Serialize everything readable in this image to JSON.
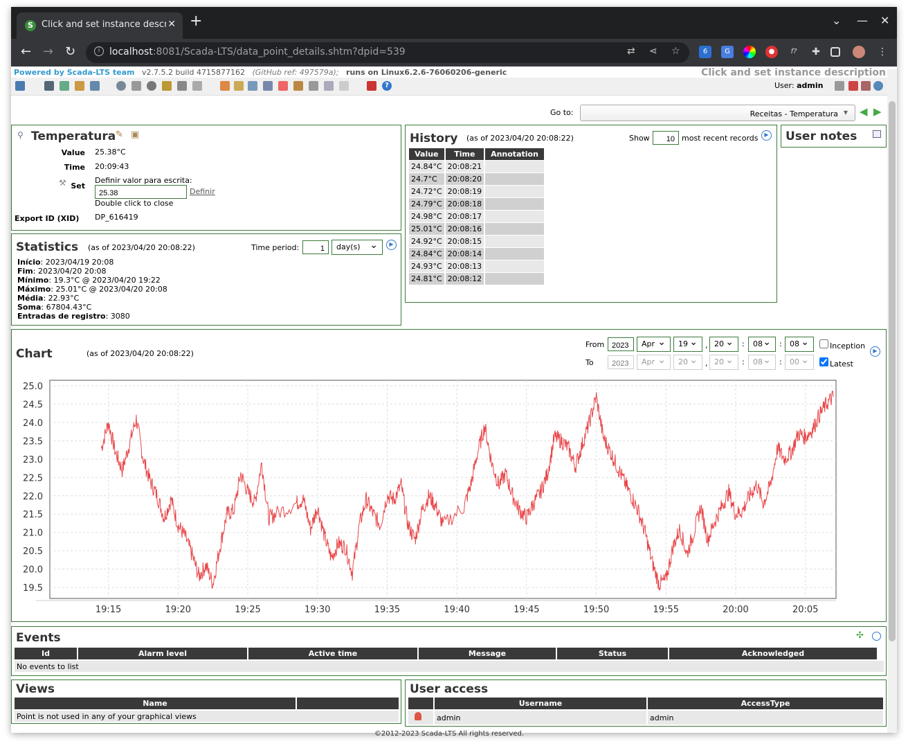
{
  "browser": {
    "tab_title": "Click and set instance descrip",
    "url_host": "localhost",
    "url_rest": ":8081/Scada-LTS/data_point_details.shtm?dpid=539",
    "ext_badge": "6"
  },
  "header": {
    "powered": "Powered by Scada-LTS team",
    "version": "v2.7.5.2 build 4715877162",
    "github": "(GitHub ref: 497579a);",
    "runs_on": "runs on Linux6.2.6-76060206-generic",
    "instance_description": "Click and set instance description",
    "user_label": "User:",
    "user_name": "admin"
  },
  "goto": {
    "label": "Go to:",
    "selected": "Receitas - Temperatura"
  },
  "point": {
    "title": "Temperatura",
    "value_label": "Value",
    "value": "25.38°C",
    "time_label": "Time",
    "time": "20:09:43",
    "set_label": "Set",
    "set_prompt": "Definir valor para escrita:",
    "set_input": "25.38",
    "set_button": "Definir",
    "set_hint": "Double click to close",
    "xid_label": "Export ID (XID)",
    "xid": "DP_616419"
  },
  "statistics": {
    "title": "Statistics",
    "asof": "(as of 2023/04/20 20:08:22)",
    "period_label": "Time period:",
    "period_value": "1",
    "period_unit": "day(s)",
    "lines": [
      {
        "k": "Início",
        "v": ": 2023/04/19 20:08"
      },
      {
        "k": "Fim",
        "v": ": 2023/04/20 20:08"
      },
      {
        "k": "Mínimo",
        "v": ": 19.3°C @ 2023/04/20 19:22"
      },
      {
        "k": "Máximo",
        "v": ": 25.01°C @ 2023/04/20 20:08"
      },
      {
        "k": "Média",
        "v": ": 22.93°C"
      },
      {
        "k": "Soma",
        "v": ": 67804.43°C"
      },
      {
        "k": "Entradas de registro",
        "v": ": 3080"
      }
    ]
  },
  "history": {
    "title": "History",
    "asof": "(as of 2023/04/20 20:08:22)",
    "show_label": "Show",
    "show_value": "10",
    "show_suffix": "most recent records",
    "columns": [
      "Value",
      "Time",
      "Annotation"
    ],
    "rows": [
      [
        "24.84°C",
        "20:08:21",
        ""
      ],
      [
        "24.7°C",
        "20:08:20",
        ""
      ],
      [
        "24.72°C",
        "20:08:19",
        ""
      ],
      [
        "24.79°C",
        "20:08:18",
        ""
      ],
      [
        "24.98°C",
        "20:08:17",
        ""
      ],
      [
        "25.01°C",
        "20:08:16",
        ""
      ],
      [
        "24.92°C",
        "20:08:15",
        ""
      ],
      [
        "24.84°C",
        "20:08:14",
        ""
      ],
      [
        "24.93°C",
        "20:08:13",
        ""
      ],
      [
        "24.81°C",
        "20:08:12",
        ""
      ]
    ]
  },
  "notes": {
    "title": "User notes"
  },
  "chart": {
    "title": "Chart",
    "asof": "(as of 2023/04/20 20:08:22)",
    "from_label": "From",
    "to_label": "To",
    "from": {
      "year": "2023",
      "month": "Apr",
      "day": "19",
      "hour": "20",
      "minute": "08",
      "second": "08"
    },
    "to": {
      "year": "2023",
      "month": "Apr",
      "day": "20",
      "hour": "20",
      "minute": "08",
      "second": "00"
    },
    "inception_label": "Inception",
    "latest_label": "Latest",
    "inception_checked": false,
    "latest_checked": true
  },
  "chart_data": {
    "type": "line",
    "title": "",
    "xlabel": "",
    "ylabel": "",
    "x_ticks": [
      "19:15",
      "19:20",
      "19:25",
      "19:30",
      "19:35",
      "19:40",
      "19:45",
      "19:50",
      "19:55",
      "20:00",
      "20:05"
    ],
    "y_ticks": [
      "25.0",
      "24.5",
      "24.0",
      "23.5",
      "23.0",
      "22.5",
      "22.0",
      "21.5",
      "21.0",
      "20.5",
      "20.0",
      "19.5"
    ],
    "ylim": [
      19.2,
      25.15
    ],
    "xlim_minutes": [
      -4.2,
      52.2
    ],
    "color": "#e8474a",
    "grid": true,
    "series": [
      {
        "x_minutes_from_19_15": [
          -0.5,
          0,
          0.5,
          1,
          1.5,
          2,
          2.5,
          3,
          3.5,
          4,
          4.5,
          5,
          5.5,
          6,
          6.5,
          7,
          7.5,
          8,
          8.5,
          9,
          9.5,
          10,
          10.5,
          11,
          11.5,
          12,
          13.5,
          14,
          14.5,
          15,
          15.5,
          16,
          16.5,
          17,
          17.5,
          18,
          18.5,
          19,
          19.5,
          20,
          20.5,
          21,
          21.5,
          22,
          22.5,
          23,
          23.5,
          24,
          25.5,
          26,
          26.5,
          27,
          27.5,
          28,
          28.5,
          29,
          29.5,
          30,
          30.5,
          31,
          31.5,
          32,
          32.5,
          33,
          33.5,
          34,
          34.5,
          35,
          35.5,
          36,
          36.5,
          37,
          37.5,
          38,
          38.5,
          39,
          39.5,
          40,
          40.5,
          41,
          41.5,
          42,
          42.5,
          43,
          43.5,
          44,
          44.5,
          45,
          45.5,
          46,
          46.5,
          47,
          47.5,
          48,
          48.5,
          49,
          49.5,
          50,
          50.5,
          51,
          51.5,
          52
        ],
        "values": [
          23.3,
          24.0,
          23.2,
          22.7,
          23.4,
          24.1,
          23.0,
          22.4,
          22.0,
          21.4,
          21.9,
          21.2,
          20.9,
          20.4,
          19.8,
          20.1,
          19.6,
          20.6,
          21.5,
          21.6,
          22.6,
          22.1,
          21.8,
          22.9,
          21.4,
          21.5,
          21.8,
          21.9,
          21.1,
          21.7,
          20.9,
          20.3,
          20.7,
          20.6,
          19.9,
          21.2,
          21.9,
          21.5,
          21.2,
          22.0,
          21.9,
          22.3,
          21.2,
          20.8,
          21.6,
          22.0,
          21.7,
          21.2,
          21.7,
          22.3,
          23.2,
          23.9,
          22.9,
          22.3,
          22.6,
          22.0,
          21.6,
          21.4,
          21.8,
          22.1,
          22.6,
          23.6,
          23.5,
          23.3,
          22.8,
          23.4,
          24.0,
          24.7,
          23.6,
          23.2,
          22.8,
          22.4,
          22.0,
          21.6,
          21.0,
          20.2,
          19.6,
          19.7,
          20.6,
          21.1,
          20.4,
          21.0,
          21.7,
          20.8,
          21.3,
          21.7,
          22.1,
          21.5,
          21.6,
          22.0,
          22.3,
          21.8,
          22.3,
          23.3,
          23.0,
          23.2,
          23.7,
          23.6,
          23.8,
          24.2,
          24.5,
          24.7
        ]
      }
    ]
  },
  "events": {
    "title": "Events",
    "columns": [
      "Id",
      "Alarm level",
      "Active time",
      "Message",
      "Status",
      "Acknowledged"
    ],
    "empty": "No events to list"
  },
  "views": {
    "title": "Views",
    "columns": [
      "Name",
      ""
    ],
    "empty": "Point is not used in any of your graphical views"
  },
  "access": {
    "title": "User access",
    "columns": [
      "",
      "Username",
      "AccessType"
    ],
    "rows": [
      [
        "admin",
        "admin"
      ]
    ]
  },
  "footer": "©2012-2023 Scada-LTS All rights reserved."
}
